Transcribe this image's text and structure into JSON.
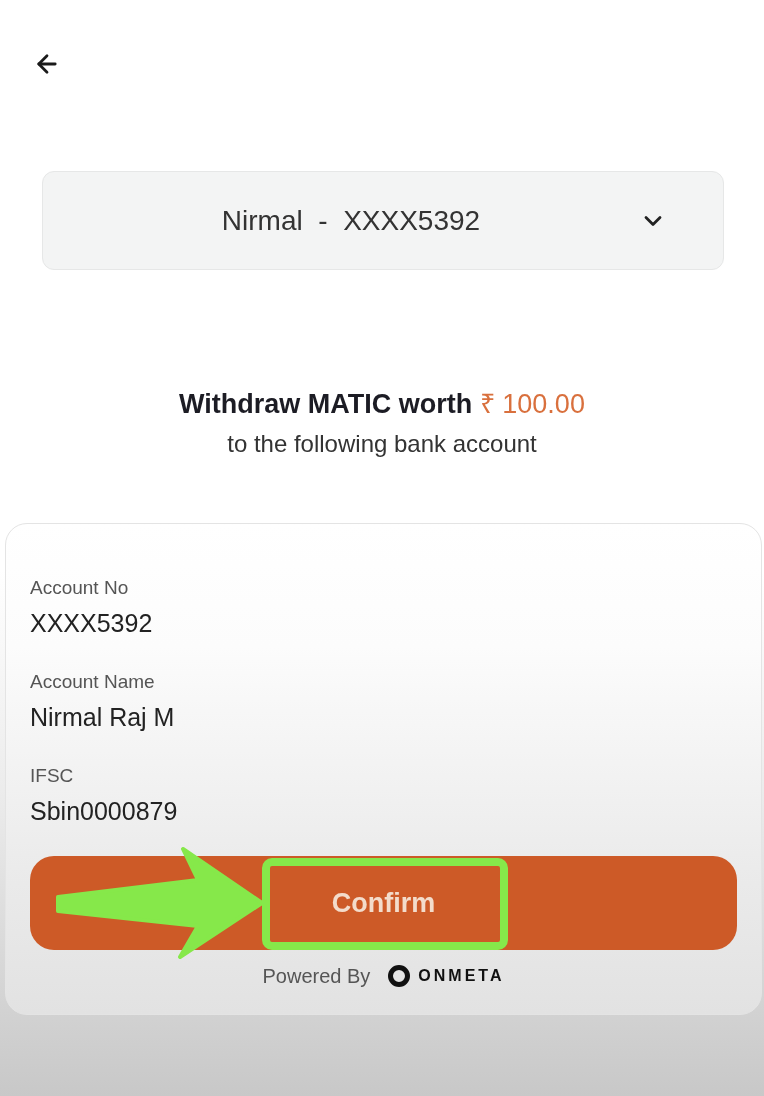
{
  "account_select": {
    "value": "Nirmal  -  XXXX5392"
  },
  "summary": {
    "title": "Withdraw MATIC worth",
    "amount": "₹ 100.00",
    "subtitle": "to the following bank account"
  },
  "details": [
    {
      "label": "Account No",
      "value": "XXXX5392"
    },
    {
      "label": "Account Name",
      "value": "Nirmal Raj M"
    },
    {
      "label": "IFSC",
      "value": "Sbin0000879"
    }
  ],
  "confirm_button": {
    "label": "Confirm"
  },
  "footer": {
    "powered_by": "Powered By",
    "brand": "ONMETA"
  }
}
